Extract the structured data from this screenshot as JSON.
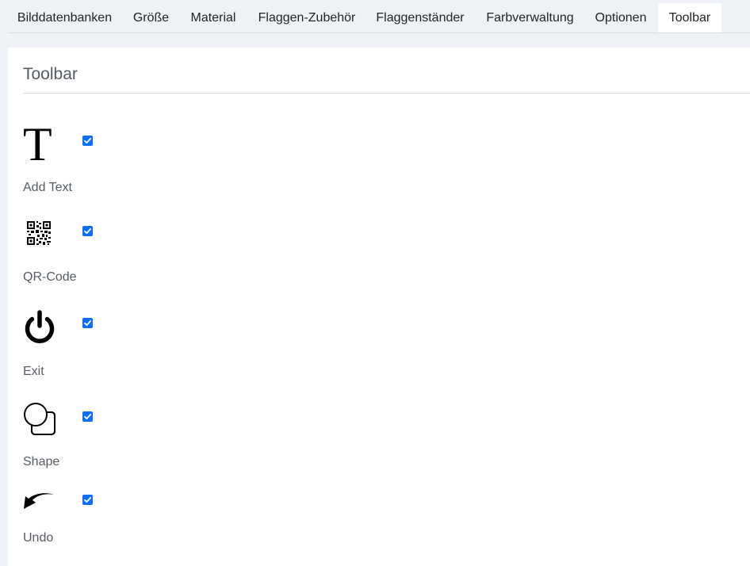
{
  "tabs": [
    {
      "label": "Bilddatenbanken",
      "active": false
    },
    {
      "label": "Größe",
      "active": false
    },
    {
      "label": "Material",
      "active": false
    },
    {
      "label": "Flaggen-Zubehör",
      "active": false
    },
    {
      "label": "Flaggenständer",
      "active": false
    },
    {
      "label": "Farbverwaltung",
      "active": false
    },
    {
      "label": "Optionen",
      "active": false
    },
    {
      "label": "Toolbar",
      "active": true
    }
  ],
  "panel": {
    "title": "Toolbar",
    "items": [
      {
        "label": "Add Text",
        "icon": "text-t-icon",
        "glyph": "T",
        "checked": true
      },
      {
        "label": "QR-Code",
        "icon": "qr-code-icon",
        "checked": true
      },
      {
        "label": "Exit",
        "icon": "power-icon",
        "checked": true
      },
      {
        "label": "Shape",
        "icon": "shape-icon",
        "checked": true
      },
      {
        "label": "Undo",
        "icon": "undo-arrow-icon",
        "checked": true
      }
    ]
  },
  "colors": {
    "accent": "#0d6efd",
    "background": "#eef1f5",
    "panel": "#ffffff",
    "label": "#555c63"
  }
}
